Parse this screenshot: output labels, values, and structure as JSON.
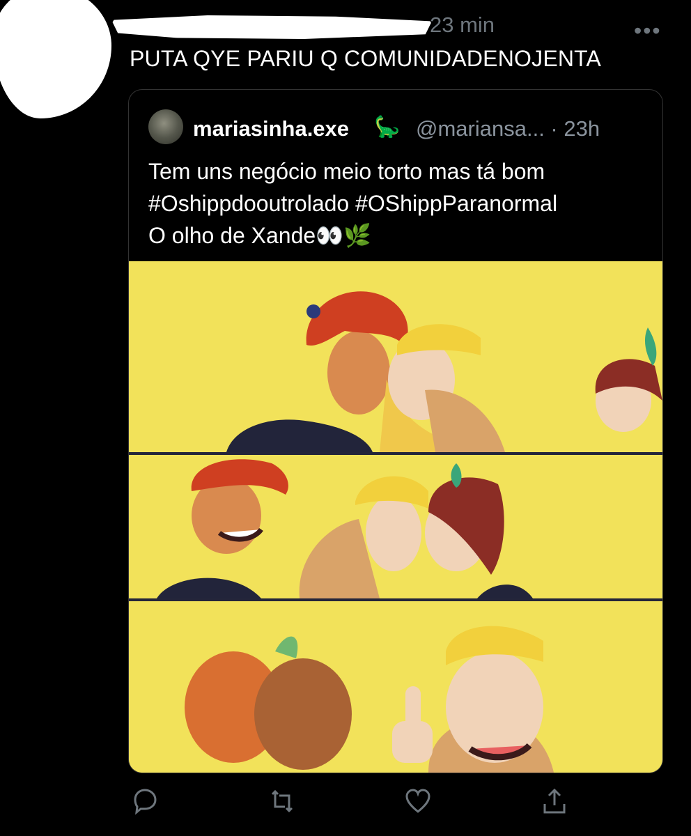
{
  "tweet": {
    "timestamp": "23 min",
    "more_label": "•••",
    "text": "PUTA QYE PARIU Q COMUNIDADENOJENTA"
  },
  "quoted": {
    "display_name": "mariasinha.exe",
    "name_emoji": "🦕",
    "meta": "@mariansa... · 23h",
    "lines": [
      "Tem uns negócio meio torto mas tá bom",
      "#Oshippdooutrolado #OShippParanormal",
      "O olho de Xande👀🌿"
    ],
    "artwork_background": "#f2e25a"
  },
  "actions": {
    "icons": [
      "reply-icon",
      "retweet-icon",
      "like-icon",
      "share-icon"
    ]
  },
  "colors": {
    "background": "#000000",
    "muted_text": "#6e767d",
    "border": "#333333"
  }
}
